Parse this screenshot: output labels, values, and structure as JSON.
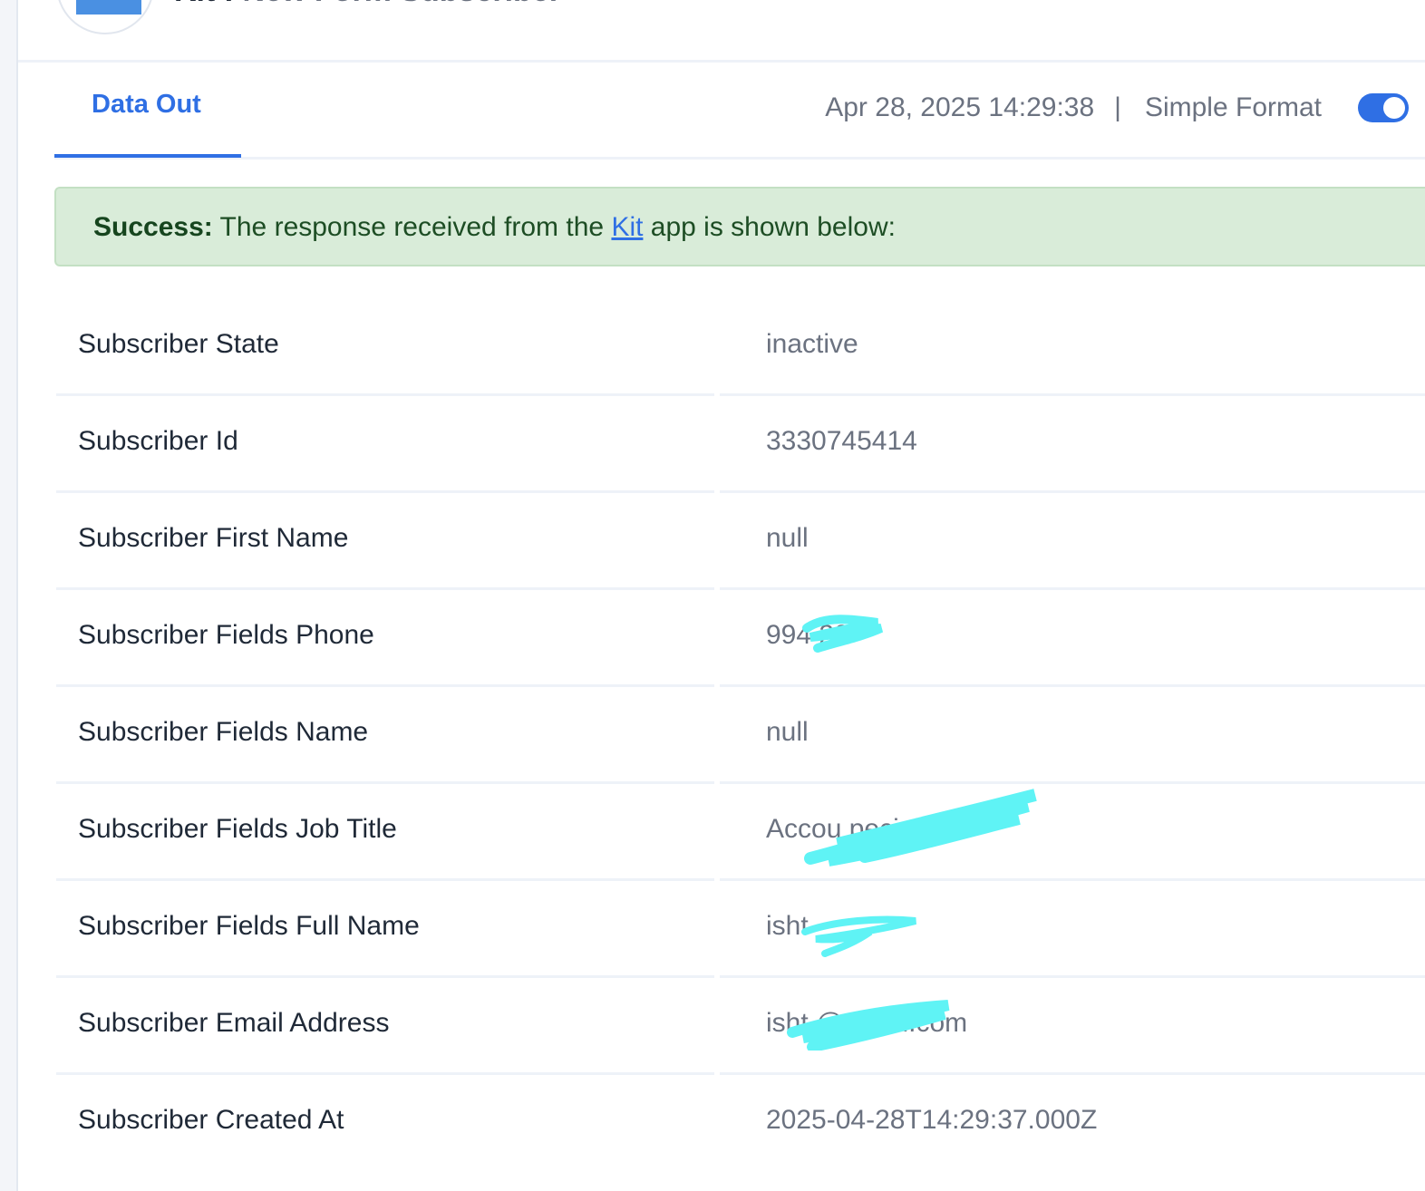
{
  "header": {
    "app_name": "Kit :",
    "trigger_name": "New Form Subscriber"
  },
  "tabs": [
    {
      "label": "Data Out"
    }
  ],
  "meta": {
    "timestamp": "Apr 28, 2025 14:29:38",
    "separator": "|",
    "format_label": "Simple Format",
    "format_toggle_on": true
  },
  "alert": {
    "prefix": "Success:",
    "text_before_link": " The response received from the ",
    "link_text": "Kit",
    "text_after_link": " app is shown below:"
  },
  "rows": [
    {
      "key": "Subscriber State",
      "value": "inactive"
    },
    {
      "key": "Subscriber Id",
      "value": "3330745414"
    },
    {
      "key": "Subscriber First Name",
      "value": "null"
    },
    {
      "key": "Subscriber Fields Phone",
      "value": "994    20"
    },
    {
      "key": "Subscriber Fields Name",
      "value": "null"
    },
    {
      "key": "Subscriber Fields Job Title",
      "value": "Accou           pecialist"
    },
    {
      "key": "Subscriber Fields Full Name",
      "value": "isht"
    },
    {
      "key": "Subscriber Email Address",
      "value": "isht         @gmail.com"
    },
    {
      "key": "Subscriber Created At",
      "value": "2025-04-28T14:29:37.000Z"
    }
  ],
  "colors": {
    "accent": "#2f6fe4",
    "success_bg": "#d9ecd9",
    "redaction": "#5ff3f5"
  }
}
